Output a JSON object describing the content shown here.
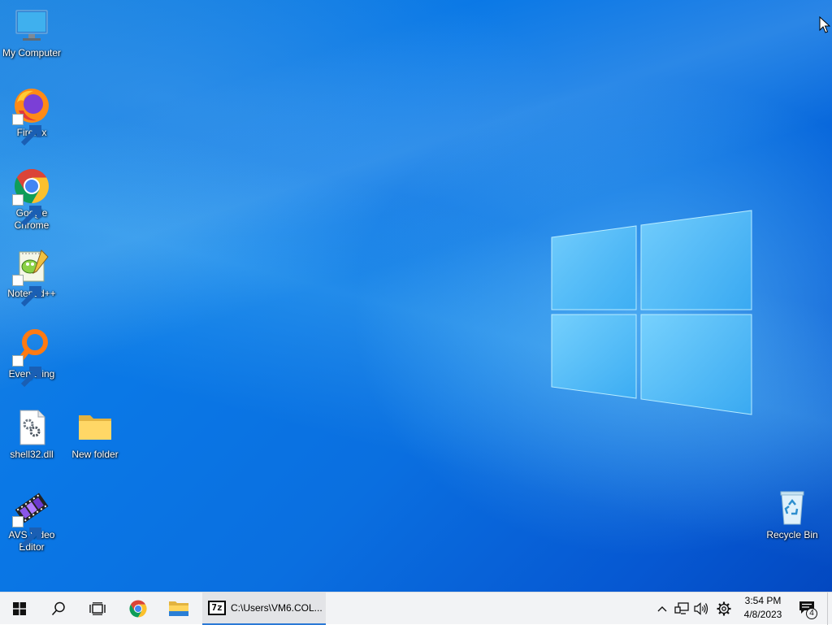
{
  "desktop": {
    "icons": [
      {
        "label": "My Computer",
        "icon": "monitor-icon"
      },
      {
        "label": "Firefox",
        "icon": "firefox-icon"
      },
      {
        "label": "Google Chrome",
        "icon": "chrome-icon"
      },
      {
        "label": "Notepad++",
        "icon": "notepadpp-icon"
      },
      {
        "label": "Everything",
        "icon": "everything-search-icon"
      },
      {
        "label": "shell32.dll",
        "icon": "dll-file-icon"
      },
      {
        "label": "New folder",
        "icon": "folder-icon"
      },
      {
        "label": "AVS Video Editor",
        "icon": "film-icon"
      },
      {
        "label": "Recycle Bin",
        "icon": "recycle-bin-icon"
      }
    ]
  },
  "taskbar": {
    "start_icon": "windows-start-icon",
    "search_icon": "search-icon",
    "taskview_icon": "task-view-icon",
    "pinned": [
      "chrome-icon",
      "file-explorer-icon"
    ],
    "active_window": {
      "icon": "7zip-icon",
      "icon_text": "7z",
      "title": "C:\\Users\\VM6.COL..."
    },
    "tray": {
      "icons": [
        "chevron-up-icon",
        "network-icon",
        "volume-icon",
        "settings-gear-icon"
      ],
      "time": "3:54 PM",
      "date": "4/8/2023",
      "notification_count": "4"
    }
  },
  "colors": {
    "taskbar_bg": "#f2f3f5",
    "active_indicator": "#2b79d6",
    "desktop_blue": "#0a78e6"
  }
}
